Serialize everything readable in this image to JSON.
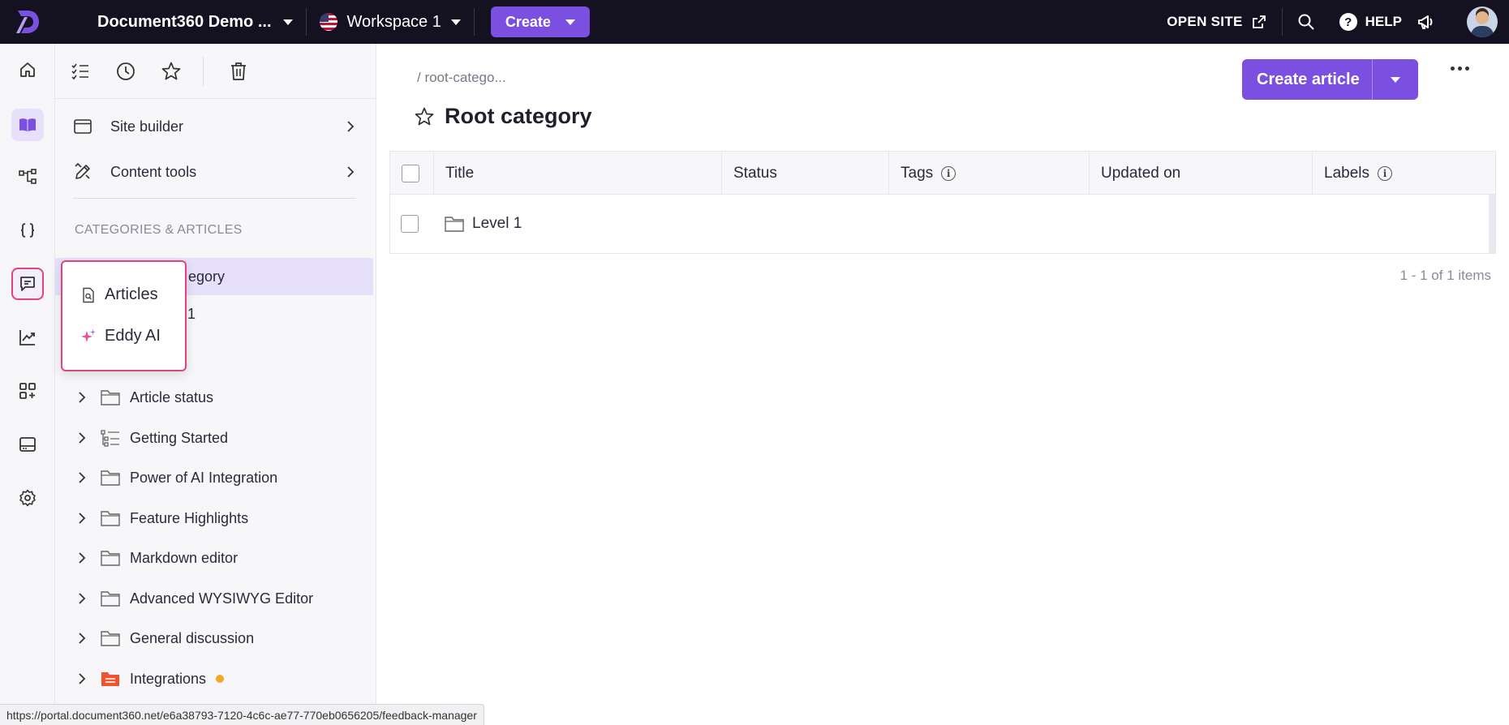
{
  "topbar": {
    "project_name": "Document360 Demo ...",
    "workspace_name": "Workspace 1",
    "create_label": "Create",
    "open_site_label": "OPEN SITE",
    "help_label": "HELP"
  },
  "rail": {
    "items": [
      "home-icon",
      "book-icon",
      "workflow-icon",
      "code-braces-icon",
      "feedback-icon",
      "analytics-icon",
      "apps-add-icon",
      "drive-icon",
      "settings-icon"
    ],
    "active": "book-icon",
    "focused": "feedback-icon"
  },
  "panel": {
    "tools": [
      "checklist-icon",
      "history-icon",
      "star-icon",
      "trash-icon"
    ],
    "menu": [
      {
        "label": "Site builder"
      },
      {
        "label": "Content tools"
      }
    ],
    "section_title": "CATEGORIES & ARTICLES",
    "tree": [
      {
        "label": "egory",
        "selected": true
      },
      {
        "label": "1"
      },
      {
        "label": "Article status",
        "icon": "folder"
      },
      {
        "label": "Getting Started",
        "icon": "tree-list"
      },
      {
        "label": "Power of AI Integration",
        "icon": "folder"
      },
      {
        "label": "Feature Highlights",
        "icon": "folder"
      },
      {
        "label": "Markdown editor",
        "icon": "folder"
      },
      {
        "label": "Advanced WYSIWYG Editor",
        "icon": "folder"
      },
      {
        "label": "General discussion",
        "icon": "folder"
      },
      {
        "label": "Integrations",
        "icon": "folder-red",
        "dot": true
      }
    ]
  },
  "popover": {
    "items": [
      {
        "label": "Articles",
        "icon": "article-search-icon"
      },
      {
        "label": "Eddy AI",
        "icon": "sparkle-icon"
      }
    ]
  },
  "main": {
    "breadcrumb": "/ root-catego...",
    "page_title": "Root category",
    "create_article_label": "Create article",
    "table": {
      "columns": [
        "Title",
        "Status",
        "Tags",
        "Updated on",
        "Labels"
      ],
      "rows": [
        {
          "title": "Level 1",
          "status": "",
          "tags": "",
          "updated_on": "",
          "labels": ""
        }
      ]
    },
    "pager": "1 - 1 of 1 items"
  },
  "statusbar": {
    "url": "https://portal.document360.net/e6a38793-7120-4c6c-ae77-770eb0656205/feedback-manager"
  },
  "colors": {
    "accent": "#7b4fe0",
    "topbar_bg": "#141221",
    "highlight": "#e0457a",
    "selected_bg": "#e7e0fb",
    "dot": "#f5a623"
  }
}
